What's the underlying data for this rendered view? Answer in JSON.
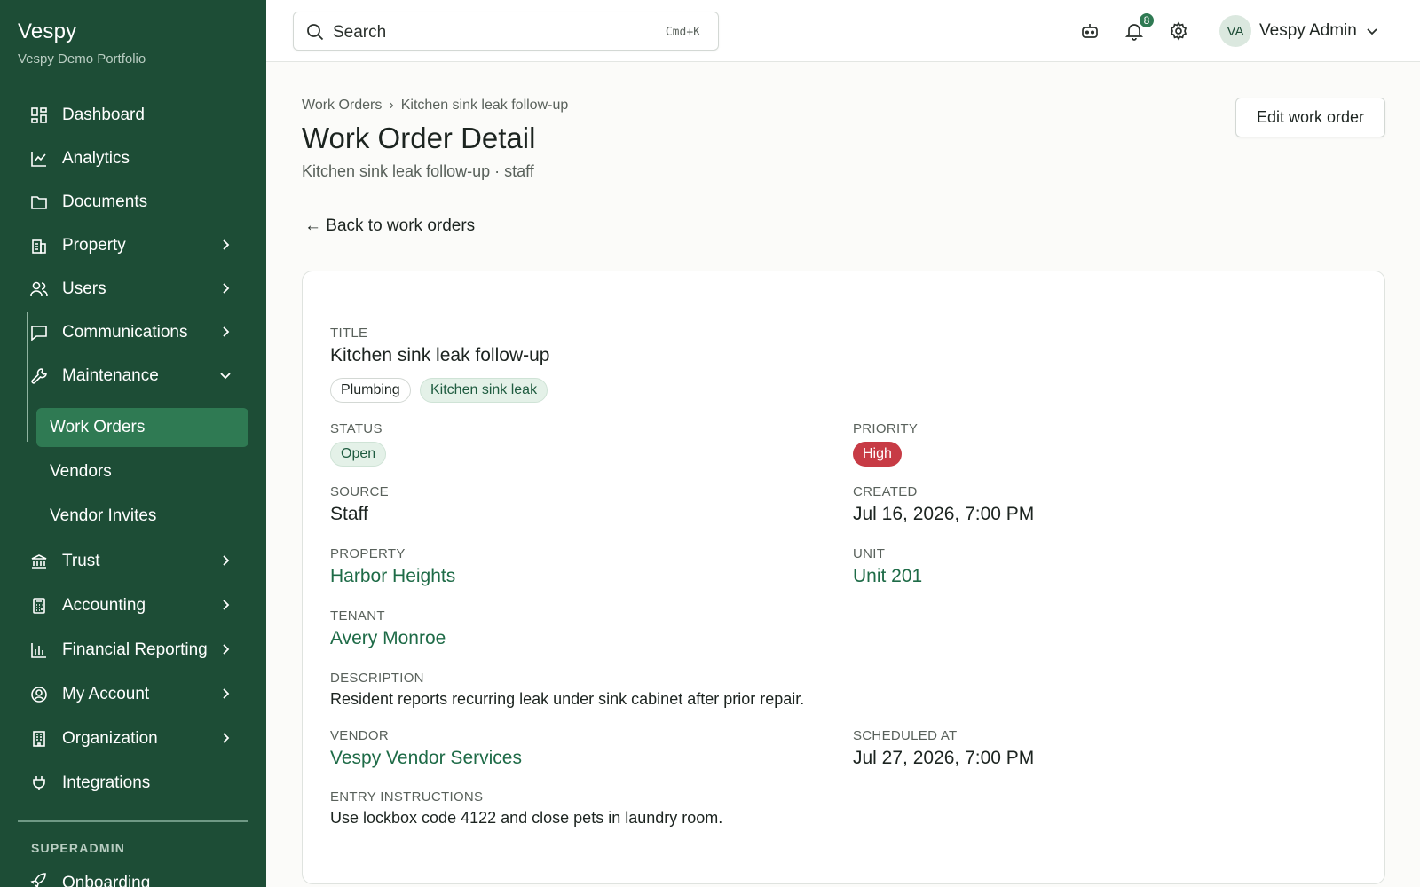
{
  "app": {
    "brand": "Vespy",
    "portfolio": "Vespy Demo Portfolio"
  },
  "sidebar": {
    "items": [
      {
        "label": "Dashboard",
        "icon": "dashboard-icon",
        "chevron": false
      },
      {
        "label": "Analytics",
        "icon": "chart-line-icon",
        "chevron": false
      },
      {
        "label": "Documents",
        "icon": "folder-icon",
        "chevron": false
      },
      {
        "label": "Property",
        "icon": "building-icon",
        "chevron": "right"
      },
      {
        "label": "Users",
        "icon": "users-icon",
        "chevron": "right"
      },
      {
        "label": "Communications",
        "icon": "message-icon",
        "chevron": "right"
      },
      {
        "label": "Maintenance",
        "icon": "wrench-icon",
        "chevron": "down"
      }
    ],
    "maintenance_sub": [
      {
        "label": "Work Orders",
        "active": true
      },
      {
        "label": "Vendors",
        "active": false
      },
      {
        "label": "Vendor Invites",
        "active": false
      }
    ],
    "items_after": [
      {
        "label": "Trust",
        "icon": "bank-icon",
        "chevron": "right"
      },
      {
        "label": "Accounting",
        "icon": "calculator-icon",
        "chevron": "right"
      },
      {
        "label": "Financial Reporting",
        "icon": "bar-chart-icon",
        "chevron": "right"
      },
      {
        "label": "My Account",
        "icon": "user-circle-icon",
        "chevron": "right"
      },
      {
        "label": "Organization",
        "icon": "office-icon",
        "chevron": "right"
      },
      {
        "label": "Integrations",
        "icon": "plug-icon",
        "chevron": false
      }
    ],
    "section_label": "SUPERADMIN",
    "section_item": "Onboarding"
  },
  "topbar": {
    "search_placeholder": "Search",
    "search_shortcut": "Cmd+K",
    "notification_count": "8",
    "avatar_initials": "VA",
    "user_name": "Vespy Admin"
  },
  "header": {
    "breadcrumb_root": "Work Orders",
    "breadcrumb_sep": "›",
    "breadcrumb_current": "Kitchen sink leak follow-up",
    "title": "Work Order Detail",
    "subtitle": "Kitchen sink leak follow-up · staff",
    "edit_label": "Edit work order",
    "back_label": "← Back to work orders"
  },
  "work_order": {
    "title_label": "TITLE",
    "title": "Kitchen sink leak follow-up",
    "tags": [
      "Plumbing",
      "Kitchen sink leak"
    ],
    "status_label": "STATUS",
    "status": "Open",
    "priority_label": "PRIORITY",
    "priority": "High",
    "source_label": "SOURCE",
    "source": "Staff",
    "created_label": "CREATED",
    "created": "Jul 16, 2026, 7:00 PM",
    "property_label": "PROPERTY",
    "property": "Harbor Heights",
    "unit_label": "UNIT",
    "unit": "Unit 201",
    "tenant_label": "TENANT",
    "tenant": "Avery Monroe",
    "description_label": "DESCRIPTION",
    "description": "Resident reports recurring leak under sink cabinet after prior repair.",
    "vendor_label": "VENDOR",
    "vendor": "Vespy Vendor Services",
    "scheduled_label": "SCHEDULED AT",
    "scheduled": "Jul 27, 2026, 7:00 PM",
    "entry_label": "ENTRY INSTRUCTIONS",
    "entry": "Use lockbox code 4122 and close pets in laundry room."
  },
  "colors": {
    "sidebar_bg": "#1d4d36",
    "active_item": "#2f7a53",
    "link": "#1e6b47",
    "priority_high": "#c73b45"
  }
}
